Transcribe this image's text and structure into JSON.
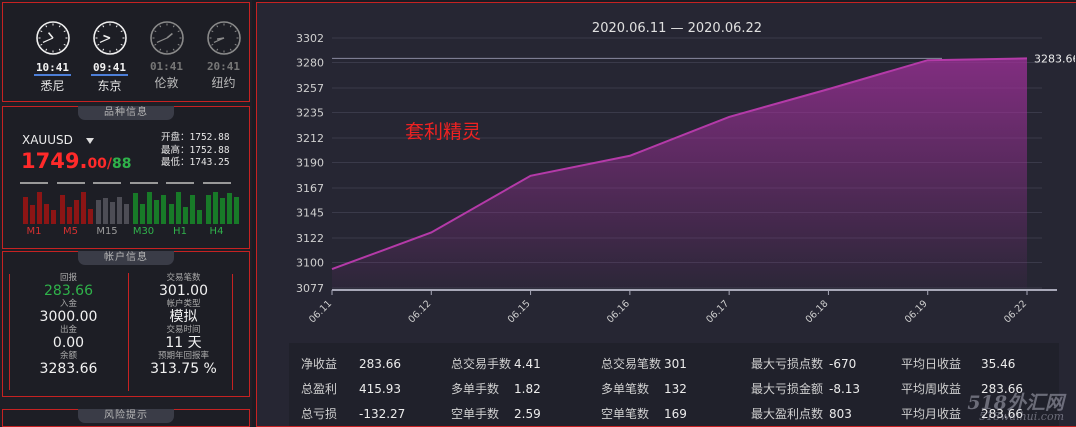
{
  "clocks": [
    {
      "time": "10:41",
      "city": "悉尼",
      "active": true
    },
    {
      "time": "09:41",
      "city": "东京",
      "active": true
    },
    {
      "time": "01:41",
      "city": "伦敦",
      "active": false
    },
    {
      "time": "20:41",
      "city": "纽约",
      "active": false
    }
  ],
  "symbol": {
    "section_title": "品种信息",
    "name": "XAUUSD",
    "price_main": "1749.",
    "price_sub": "00",
    "price_slash": "/",
    "price_ask": "88",
    "open_label": "开盘：",
    "open_value": "1752.88",
    "high_label": "最高：",
    "high_value": "1752.88",
    "low_label": "最低：",
    "low_value": "1743.25",
    "timeframes": [
      {
        "label": "M1",
        "trend": "red",
        "levels": [
          0.8,
          0.55,
          0.95,
          0.6,
          0.4
        ]
      },
      {
        "label": "M5",
        "trend": "red",
        "levels": [
          0.85,
          0.5,
          0.7,
          0.95,
          0.45
        ]
      },
      {
        "label": "M15",
        "trend": "gray",
        "levels": [
          0.7,
          0.75,
          0.65,
          0.8,
          0.6
        ]
      },
      {
        "label": "M30",
        "trend": "green",
        "levels": [
          0.9,
          0.6,
          0.95,
          0.7,
          0.85
        ]
      },
      {
        "label": "H1",
        "trend": "green",
        "levels": [
          0.6,
          0.95,
          0.5,
          0.85,
          0.4
        ]
      },
      {
        "label": "H4",
        "trend": "green",
        "levels": [
          0.85,
          0.95,
          0.75,
          0.9,
          0.8
        ]
      }
    ]
  },
  "account": {
    "section_title": "帐户信息",
    "rows": [
      [
        {
          "label": "回报",
          "value": "283.66",
          "color": "green"
        },
        {
          "label": "交易笔数",
          "value": "301.00"
        }
      ],
      [
        {
          "label": "入金",
          "value": "3000.00"
        },
        {
          "label": "帐户类型",
          "value": "模拟"
        }
      ],
      [
        {
          "label": "出金",
          "value": "0.00"
        },
        {
          "label": "交易时间",
          "value": "11 天"
        }
      ],
      [
        {
          "label": "余额",
          "value": "3283.66"
        },
        {
          "label": "预期年回报率",
          "value": "313.75 %"
        }
      ]
    ]
  },
  "risk": {
    "section_title": "风险提示"
  },
  "chart_overlay_text": "套利精灵",
  "chart_data": {
    "type": "area",
    "title": "2020.06.11 — 2020.06.22",
    "x": [
      "06.11",
      "06.12",
      "06.15",
      "06.16",
      "06.17",
      "06.18",
      "06.19",
      "06.22"
    ],
    "values": [
      3094,
      3127,
      3178,
      3196,
      3231,
      3256,
      3282,
      3283.66
    ],
    "last_label": "3283.66",
    "y_ticks": [
      3077,
      3100,
      3122,
      3145,
      3167,
      3190,
      3212,
      3235,
      3257,
      3280,
      3302
    ],
    "ylim": [
      3077,
      3302
    ],
    "grid": true,
    "color": "#a0309a"
  },
  "stats": [
    [
      {
        "label": "净收益",
        "value": "283.66"
      },
      {
        "label": "总盈利",
        "value": "415.93"
      },
      {
        "label": "总亏损",
        "value": "-132.27"
      }
    ],
    [
      {
        "label": "总交易手数",
        "value": "4.41"
      },
      {
        "label": "多单手数",
        "value": "1.82"
      },
      {
        "label": "空单手数",
        "value": "2.59"
      }
    ],
    [
      {
        "label": "总交易笔数",
        "value": "301"
      },
      {
        "label": "多单笔数",
        "value": "132"
      },
      {
        "label": "空单笔数",
        "value": "169"
      }
    ],
    [
      {
        "label": "最大亏损点数",
        "value": "-670"
      },
      {
        "label": "最大亏损金额",
        "value": "-8.13"
      },
      {
        "label": "最大盈利点数",
        "value": "803"
      }
    ],
    [
      {
        "label": "平均日收益",
        "value": "35.46"
      },
      {
        "label": "平均周收益",
        "value": "283.66"
      },
      {
        "label": "平均月收益",
        "value": "283.66"
      }
    ]
  ],
  "site_watermark": {
    "line1": "518外汇网",
    "line2": "518waihui.com"
  }
}
